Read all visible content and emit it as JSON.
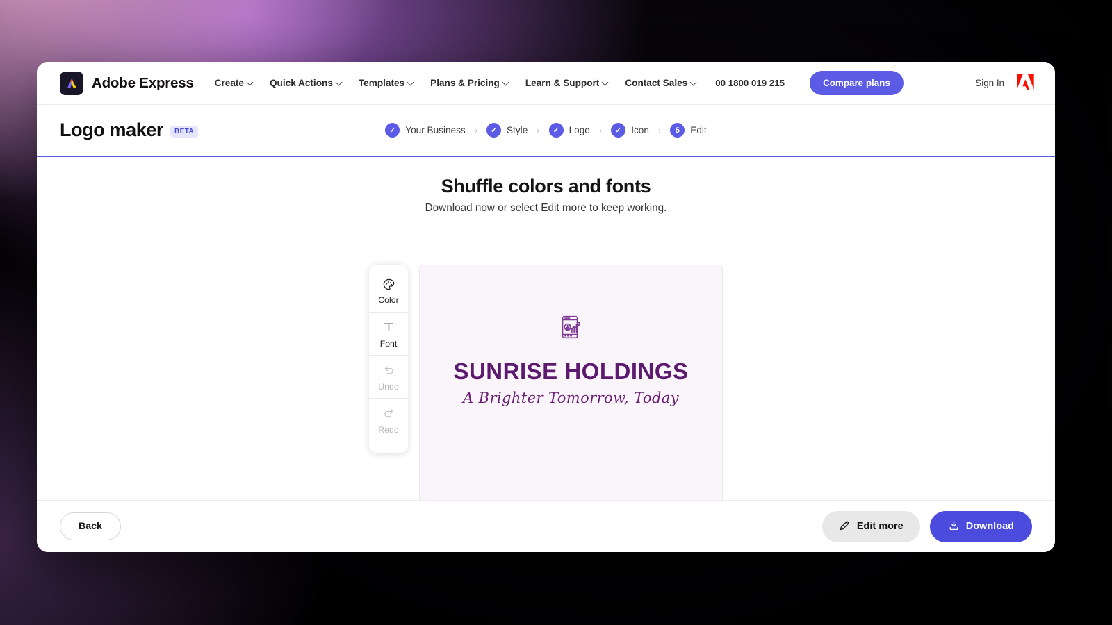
{
  "globalnav": {
    "brand": "Adobe Express",
    "brand_icon": "adobe-express-logo-icon",
    "links": [
      {
        "label": "Create",
        "has_chevron": true
      },
      {
        "label": "Quick Actions",
        "has_chevron": true
      },
      {
        "label": "Templates",
        "has_chevron": true
      },
      {
        "label": "Plans & Pricing",
        "has_chevron": true
      },
      {
        "label": "Learn & Support",
        "has_chevron": true
      },
      {
        "label": "Contact Sales",
        "has_chevron": true
      }
    ],
    "phone": "00 1800 019 215",
    "compare_plans": "Compare plans",
    "sign_in": "Sign In",
    "adobe_logo_icon": "adobe-logo-icon"
  },
  "productbar": {
    "title": "Logo maker",
    "badge": "BETA",
    "steps": [
      {
        "label": "Your Business",
        "marker": "✓",
        "complete": true
      },
      {
        "label": "Style",
        "marker": "✓",
        "complete": true
      },
      {
        "label": "Logo",
        "marker": "✓",
        "complete": true
      },
      {
        "label": "Icon",
        "marker": "✓",
        "complete": true
      },
      {
        "label": "Edit",
        "marker": "5",
        "complete": false
      }
    ],
    "separator": "›"
  },
  "main": {
    "heading": "Shuffle colors and fonts",
    "subheading": "Download now or select Edit more to keep working.",
    "toolbar": [
      {
        "label": "Color",
        "icon": "palette-icon",
        "disabled": false
      },
      {
        "label": "Font",
        "icon": "text-format-icon",
        "disabled": false
      },
      {
        "label": "Undo",
        "icon": "undo-arrow-icon",
        "disabled": true
      },
      {
        "label": "Redo",
        "icon": "redo-arrow-icon",
        "disabled": true
      }
    ],
    "logo": {
      "icon": "smartphone-growth-chart-icon",
      "name": "SUNRISE HOLDINGS",
      "tagline": "A Brighter Tomorrow, Today",
      "text_color": "#5c1a6e",
      "background_color": "#faf4fb"
    }
  },
  "footer": {
    "back": "Back",
    "edit_more": "Edit more",
    "edit_more_icon": "pencil-icon",
    "download": "Download",
    "download_icon": "download-icon"
  },
  "colors": {
    "accent_blue": "#5b5be6",
    "download_blue": "#4b4bdd",
    "badge_bg": "#e6e6fb",
    "adobe_red": "#fa0f00",
    "logo_purple": "#5c1a6e"
  }
}
